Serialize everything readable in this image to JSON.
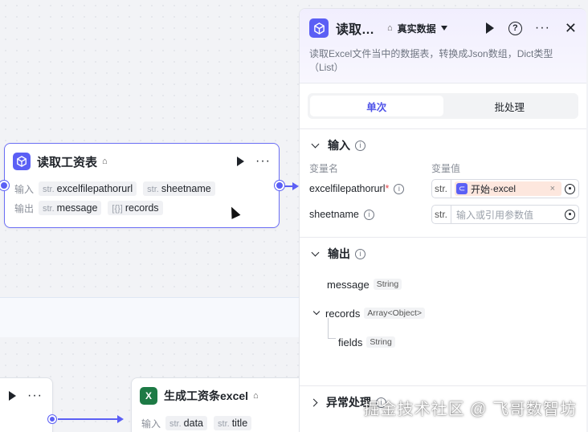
{
  "node_read": {
    "title": "读取工资表",
    "input_label": "输入",
    "output_label": "输出",
    "inputs": [
      {
        "type": "str.",
        "name": "excelfilepathorurl"
      },
      {
        "type": "str.",
        "name": "sheetname"
      }
    ],
    "outputs": [
      {
        "type": "str.",
        "name": "message"
      },
      {
        "type": "[{}]",
        "name": "records"
      }
    ]
  },
  "node_gen": {
    "title": "生成工资条excel",
    "input_label": "输入",
    "inputs": [
      {
        "type": "str.",
        "name": "data"
      },
      {
        "type": "str.",
        "name": "title"
      }
    ]
  },
  "panel": {
    "title": "读取…",
    "mode_select": "真实数据",
    "help": "?",
    "more": "···",
    "close": "✕",
    "description": "读取Excel文件当中的数据表，转换成Json数组，Dict类型（List）",
    "tabs": [
      {
        "label": "单次",
        "active": true
      },
      {
        "label": "批处理",
        "active": false
      }
    ],
    "input_section": {
      "title": "输入",
      "col_name": "变量名",
      "col_value": "变量值",
      "fields": [
        {
          "name": "excelfilepathorurl",
          "required": "*",
          "prefix": "str.",
          "ref_node": "开始",
          "ref_sep": " · ",
          "ref_var": "excel",
          "clear": "×"
        },
        {
          "name": "sheetname",
          "prefix": "str.",
          "placeholder": "输入或引用参数值"
        }
      ]
    },
    "output_section": {
      "title": "输出",
      "items": [
        {
          "name": "message",
          "type": "String"
        },
        {
          "name": "records",
          "type": "Array<Object>"
        },
        {
          "name": "fields",
          "type": "String"
        }
      ]
    },
    "error_section": {
      "title": "异常处理"
    }
  },
  "watermark": "掘金技术社区 @ 飞哥数智坊",
  "colors": {
    "accent": "#5b5ff5",
    "ref_bg": "#fde7de",
    "required": "#e5484d"
  }
}
